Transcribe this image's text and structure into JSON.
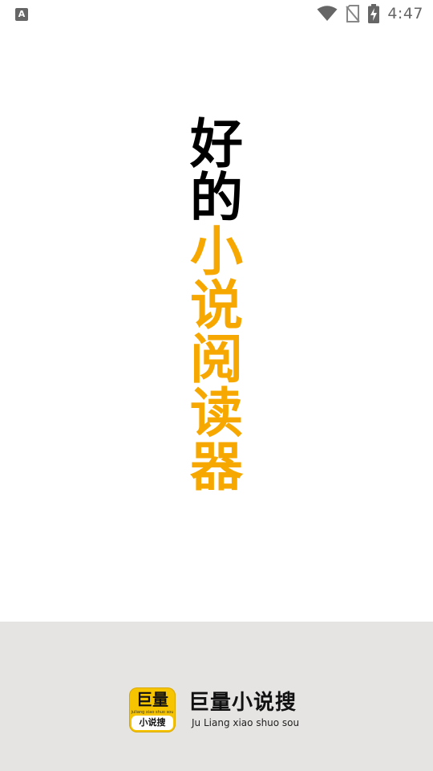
{
  "status_bar": {
    "left_icon": "A",
    "time": "4:47",
    "icons": [
      "wifi-icon",
      "no-sim-icon",
      "battery-charging-icon"
    ]
  },
  "slogan": {
    "black_chars": [
      "好",
      "的"
    ],
    "orange_chars": [
      "小",
      "说",
      "阅",
      "读",
      "器"
    ],
    "colors": {
      "black": "#000000",
      "orange": "#f7a800"
    }
  },
  "brand": {
    "icon_top": "巨量",
    "icon_tagline": "juliang xiao shuo sou",
    "icon_bottom": "小说搜",
    "name": "巨量小说搜",
    "pinyin": "Ju Liang xiao shuo sou",
    "colors": {
      "icon_bg": "#f6c400",
      "footer_bg": "#e6e4e3"
    }
  }
}
